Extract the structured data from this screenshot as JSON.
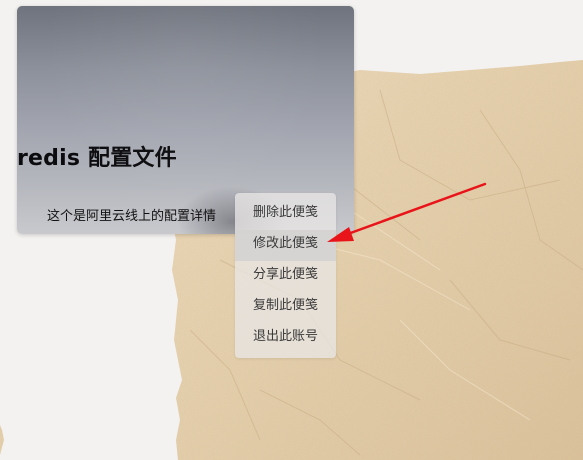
{
  "note": {
    "title": "redis 配置文件",
    "body": "这个是阿里云线上的配置详情"
  },
  "context_menu": {
    "items": [
      {
        "label": "删除此便笺"
      },
      {
        "label": "修改此便笺"
      },
      {
        "label": "分享此便笺"
      },
      {
        "label": "复制此便笺"
      },
      {
        "label": "退出此账号"
      }
    ],
    "highlighted_item": "修改此便笺"
  },
  "colors": {
    "annotation_arrow": "#e8141a",
    "paper": "#e7d3b1",
    "menu_background": "#e8e6e4",
    "menu_highlight": "#d4d3d2"
  },
  "icons": {
    "annotation": "red-arrow-pointer"
  }
}
